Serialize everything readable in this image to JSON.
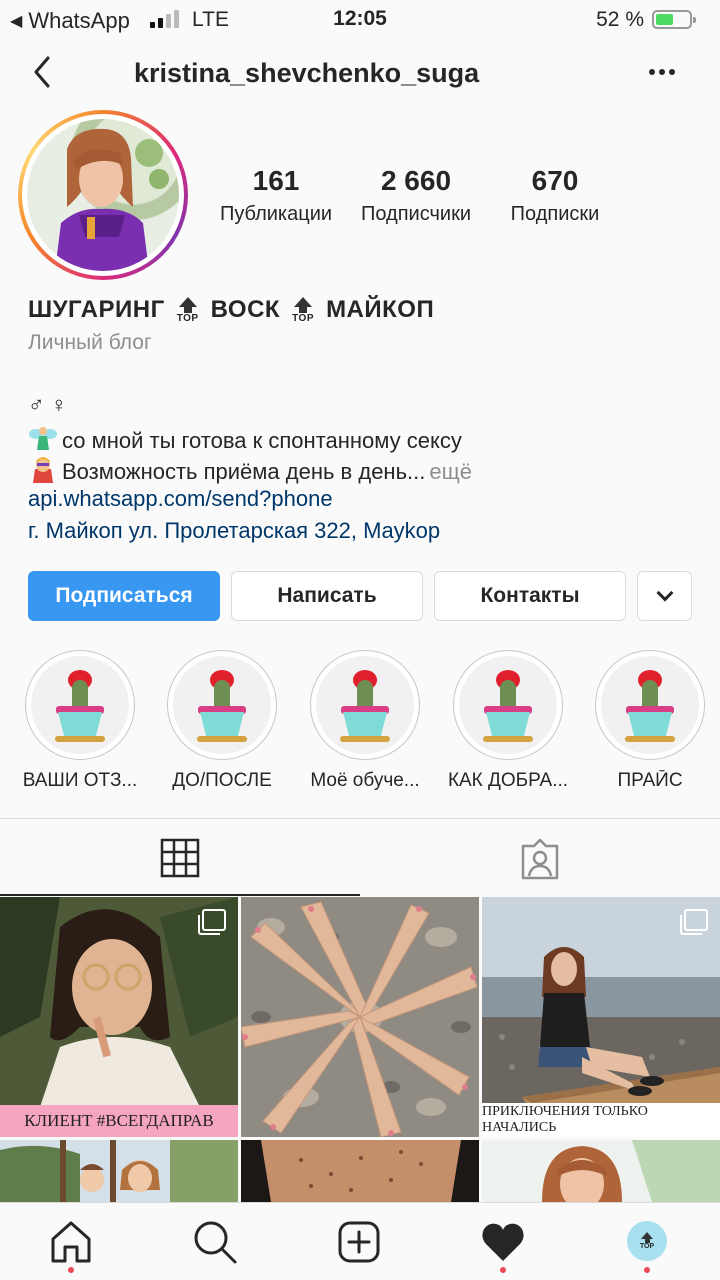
{
  "status_bar": {
    "back_app": "WhatsApp",
    "network": "LTE",
    "time": "12:05",
    "battery": "52 %",
    "battery_level": 0.52
  },
  "header": {
    "username": "kristina_shevchenko_suga",
    "back_icon": "chevron-left-icon",
    "more_icon": "more-dots-icon"
  },
  "stats": [
    {
      "value": "161",
      "label": "Публикации"
    },
    {
      "value": "2 660",
      "label": "Подписчики"
    },
    {
      "value": "670",
      "label": "Подписки"
    }
  ],
  "bio": {
    "name_parts": [
      "ШУГАРИНГ",
      "ВОСК",
      "МАЙКОП"
    ],
    "badge_text": "TOP",
    "category": "Личный блог",
    "gender_line": "♂ ♀",
    "line1": "со мной ты готова к спонтанному сексу",
    "line2": "Возможность приёма день в день...",
    "more": "ещё",
    "link": "api.whatsapp.com/send?phone",
    "address": "г. Майкоп ул. Пролетарская 322, Maykop"
  },
  "buttons": {
    "follow": "Подписаться",
    "message": "Написать",
    "contacts": "Контакты",
    "dropdown_icon": "chevron-down-icon"
  },
  "highlights": [
    {
      "label": "ВАШИ ОТЗ..."
    },
    {
      "label": "ДО/ПОСЛЕ"
    },
    {
      "label": "Моё обуче..."
    },
    {
      "label": "КАК ДОБРА..."
    },
    {
      "label": "ПРАЙС"
    }
  ],
  "tabs": {
    "grid_icon": "grid-icon",
    "tagged_icon": "tagged-person-icon"
  },
  "posts": [
    {
      "caption": "КЛИЕНТ #ВСЕГДАПРАВ",
      "multi": true
    },
    {
      "caption": "",
      "multi": false
    },
    {
      "caption": "ПРИКЛЮЧЕНИЯ ТОЛЬКО НАЧАЛИСЬ",
      "multi": true
    }
  ],
  "nav": {
    "home_icon": "home-icon",
    "search_icon": "search-icon",
    "add_icon": "add-post-icon",
    "activity_icon": "heart-icon",
    "profile_icon": "profile-avatar-icon",
    "profile_badge": "TOP"
  },
  "colors": {
    "primary_button": "#3897f0",
    "link": "#00376b",
    "notification_dot": "#ed4956",
    "caption_pink": "#f6a5c0"
  }
}
